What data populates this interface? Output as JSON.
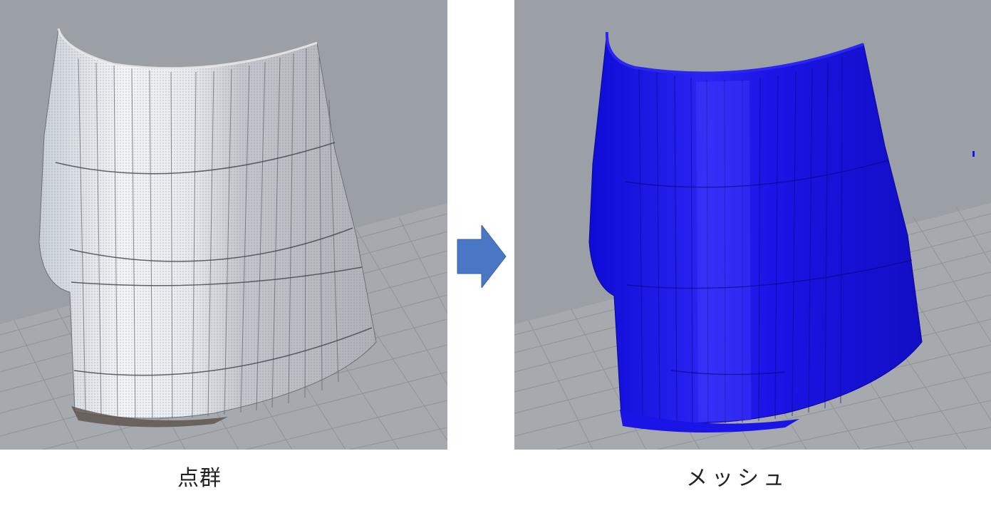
{
  "captions": {
    "left": "点群",
    "right": "メッシュ"
  },
  "colors": {
    "viewport_background": "#9aa0a6",
    "grid_plane": "#a7abaf",
    "grid_line": "#888d92",
    "point_cloud": "#d8dde2",
    "mesh": "#1a14e6",
    "arrow": "#4a77c4"
  },
  "panels": [
    {
      "name": "point-cloud-view",
      "render": "point-cloud"
    },
    {
      "name": "mesh-view",
      "render": "mesh"
    }
  ]
}
